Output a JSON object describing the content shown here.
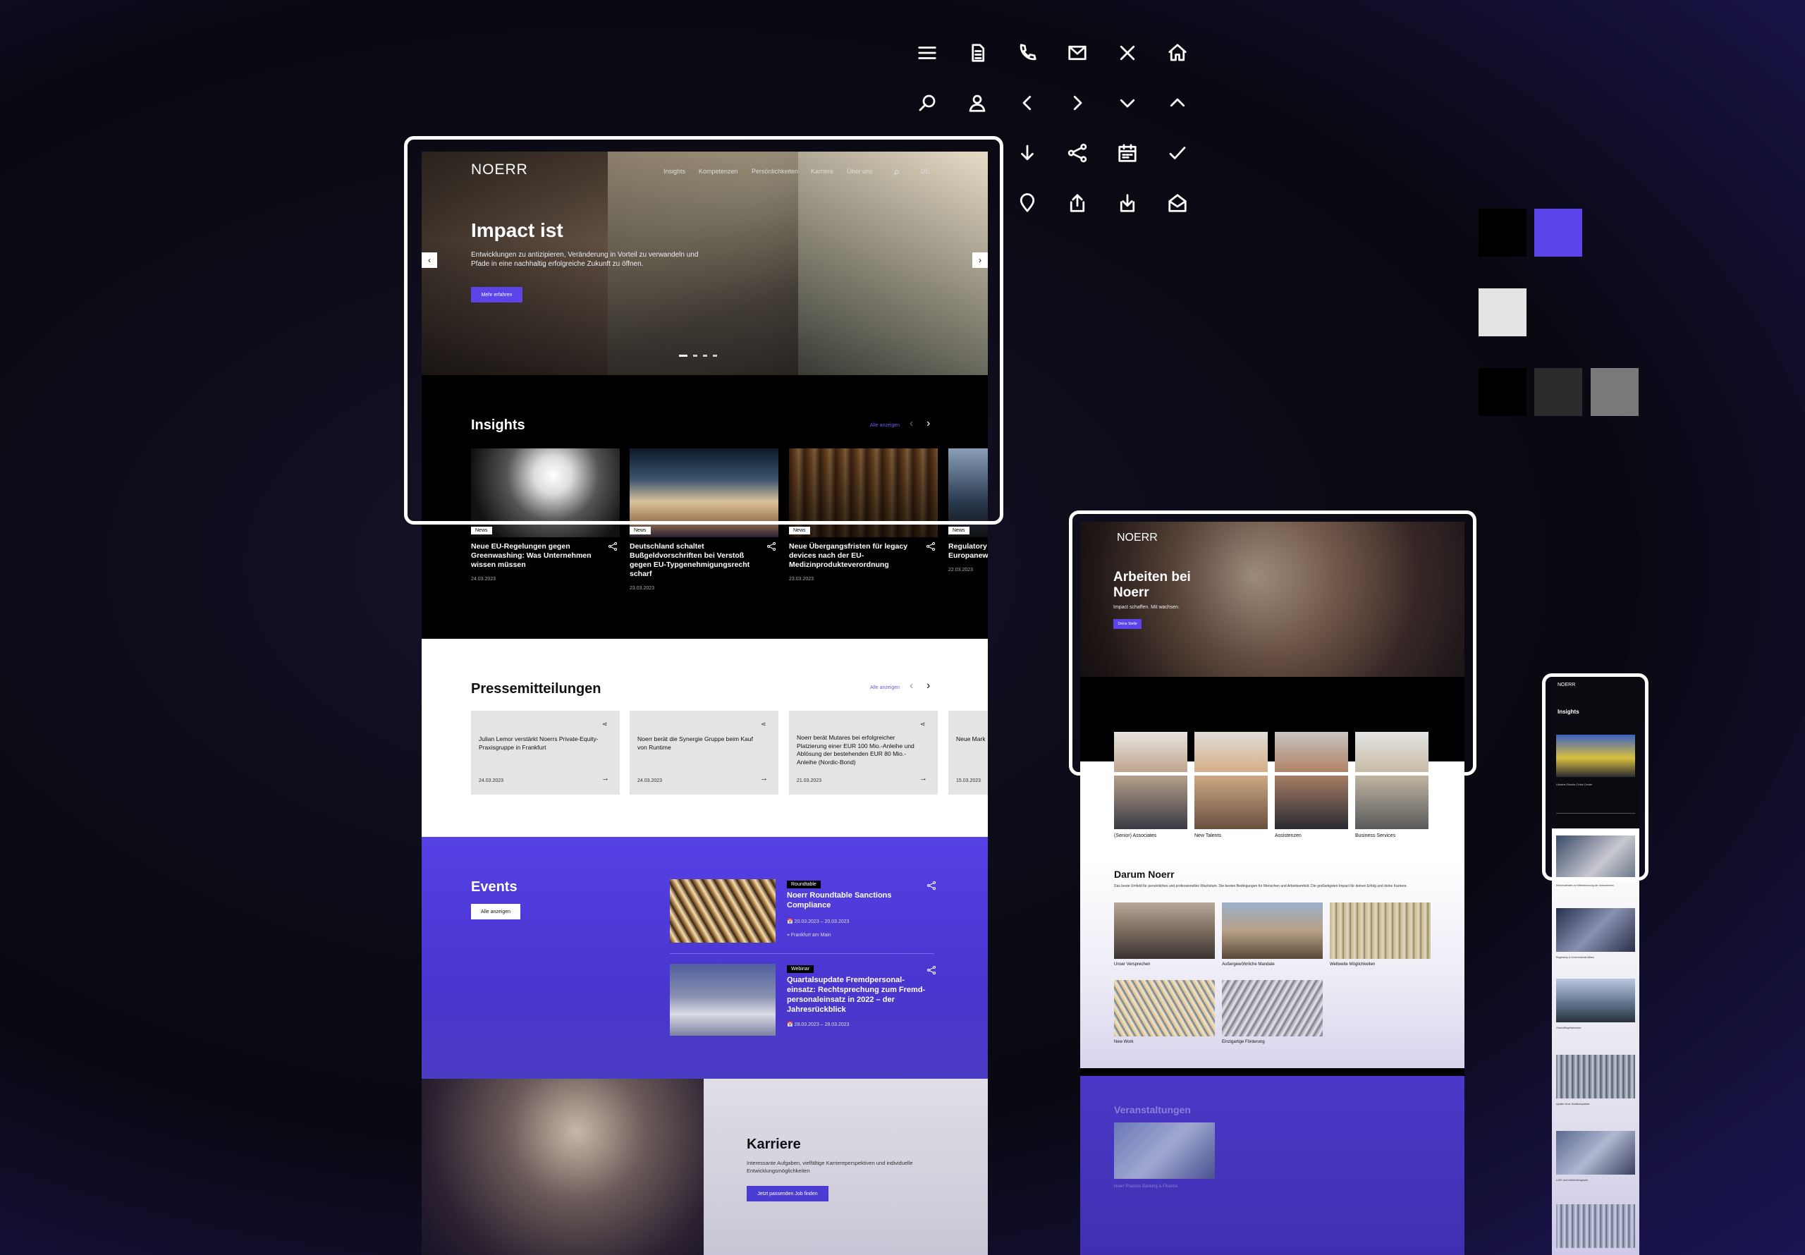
{
  "colors": {
    "accent": "#5b45e8",
    "black": "#000000",
    "light_gray": "#e4e4e4",
    "dark_gray": "#2c2c2c",
    "mid_gray": "#7a7a7a"
  },
  "icons": [
    "menu-icon",
    "document-icon",
    "phone-icon",
    "mail-icon",
    "close-icon",
    "home-icon",
    "search-icon",
    "user-icon",
    "chevron-left-icon",
    "chevron-right-icon",
    "chevron-down-icon",
    "chevron-up-icon",
    "arrow-down-icon",
    "share-icon",
    "calendar-icon",
    "check-icon",
    "location-icon",
    "upload-icon",
    "download-icon",
    "mail-open-icon"
  ],
  "desktop": {
    "logo": "NOERR",
    "nav": [
      "Insights",
      "Kompetenzen",
      "Persönlichkeiten",
      "Karriere",
      "Über uns",
      "DE"
    ],
    "hero": {
      "title": "Impact ist",
      "text": "Entwicklungen zu antizipieren, Veränderung in Vorteil zu verwandeln und Pfade in eine nachhaltig erfolgreiche Zukunft zu öffnen.",
      "button": "Mehr erfahren"
    },
    "insights": {
      "title": "Insights",
      "all_link": "Alle anzeigen",
      "cards": [
        {
          "badge": "News",
          "title": "Neue EU-Regelungen gegen Greenwashing: Was Unternehmen wissen müssen",
          "date": "24.03.2023"
        },
        {
          "badge": "News",
          "title": "Deutschland schaltet Bußgeldvorschriften bei Verstoß gegen EU-Typgenehmigungsrecht scharf",
          "date": "23.03.2023"
        },
        {
          "badge": "News",
          "title": "Neue Übergangsfristen für legacy devices nach der EU-Medizinprodukteverordnung",
          "date": "23.03.2023"
        },
        {
          "badge": "News",
          "title": "Regulatory Europanew",
          "date": "22.03.2023"
        }
      ]
    },
    "press": {
      "title": "Pressemitteilungen",
      "all_link": "Alle anzeigen",
      "cards": [
        {
          "title": "Julian Lemor verstärkt Noerrs Private-Equity-Praxisgruppe in Frankfurt",
          "date": "24.03.2023"
        },
        {
          "title": "Noerr berät die Synergie Gruppe beim Kauf von Runtime",
          "date": "24.03.2023"
        },
        {
          "title": "Noerr berät Mutares bei erfolgreicher Platzierung einer EUR 100 Mio.-Anleihe und Ablösung der bestehenden EUR 80 Mio.-Anleihe (Nordic-Bond)",
          "date": "21.03.2023"
        },
        {
          "title": "Neue Mark",
          "date": "15.03.2023"
        }
      ]
    },
    "events": {
      "title": "Events",
      "button": "Alle anzeigen",
      "items": [
        {
          "badge": "Roundtable",
          "title": "Noerr Roundtable Sanctions Compliance",
          "date": "20.03.2023 – 20.03.2023",
          "location": "Frankfurt am Main"
        },
        {
          "badge": "Webinar",
          "title": "Quartalsupdate Fremdpersonal-einsatz: Rechtsprechung zum Fremd-personaleinsatz in 2022 – der Jahresrückblick",
          "date": "28.03.2023 – 28.03.2023"
        }
      ]
    },
    "career": {
      "title": "Karriere",
      "text": "Interessante Aufgaben, vielfältige Karriereperspektiven und individuelle Entwicklungsmöglichkeiten",
      "button": "Jetzt passenden Job finden"
    }
  },
  "tablet": {
    "logo": "NOERR",
    "hero_title": "Arbeiten bei Noerr",
    "hero_text": "Impact schaffen. Mit wachsen.",
    "hero_button": "Deine Stelle",
    "people": [
      "(Senior) Associates",
      "New Talents",
      "Assistenzen",
      "Business Services"
    ],
    "darum_title": "Darum Noerr",
    "darum_text": "Das beste Umfeld für persönliches und professionelles Wachstum. Die besten Bedingungen für Menschen und Arbeitsumfeld. Die großartigsten Impact für deinen Erfolg und deine Karriere.",
    "tiles": [
      "Unser Versprechen",
      "Außergewöhnliche Mandate",
      "Weltweite Möglichkeiten",
      "New Work",
      "Einzigartige Förderung"
    ],
    "events_title": "Veranstaltungen",
    "event_caption": "Noerr Practice Banking & Finance"
  },
  "phone": {
    "logo": "NOERR",
    "title": "Insights",
    "item1": "Ukraine-Russia Crisis Center",
    "captions": [
      "Reformdebatte zur Mitbestimmung der Unternehmen",
      "Regulatory & Governmental Affairs",
      "Geschäftsgeheimnisse",
      "Update Neue Sanktionspakete",
      "LkSG und Lieferkettengesetz"
    ]
  }
}
